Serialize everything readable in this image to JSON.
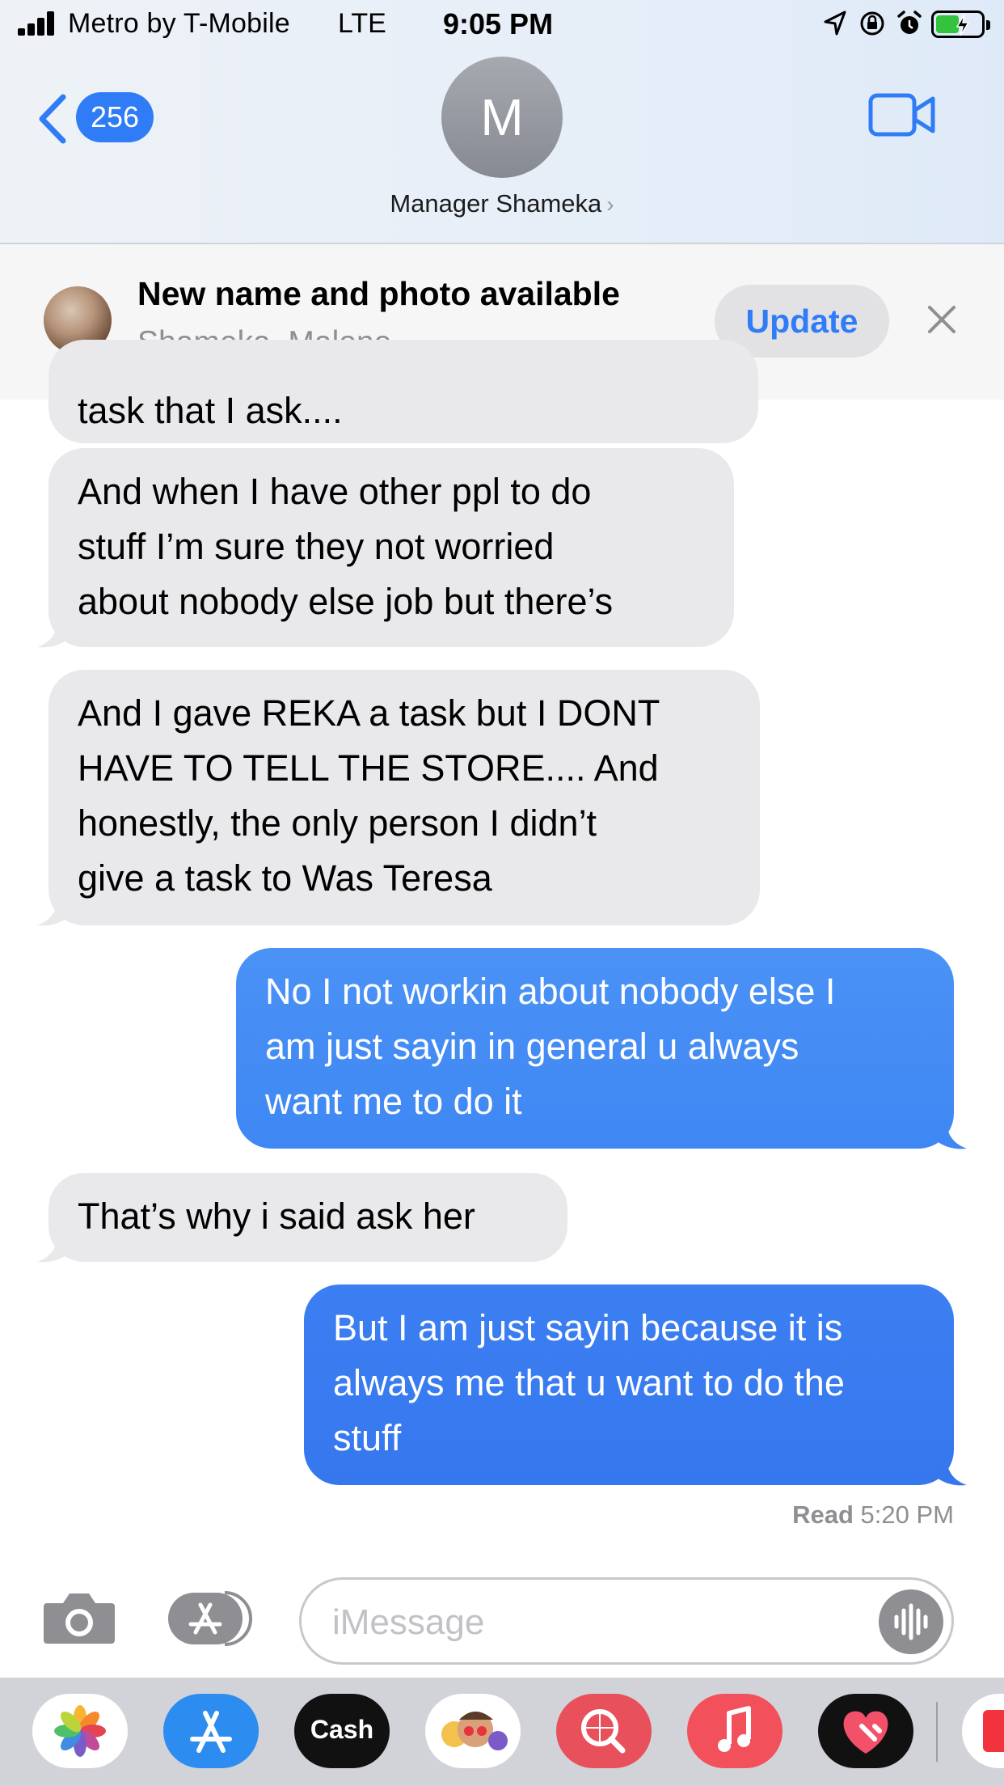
{
  "status_bar": {
    "carrier": "Metro by T-Mobile",
    "network": "LTE",
    "time": "9:05 PM",
    "icons": [
      "signal-bars-icon",
      "location-arrow-icon",
      "orientation-lock-icon",
      "alarm-icon",
      "battery-charging-icon"
    ]
  },
  "header": {
    "back_count": "256",
    "avatar_initial": "M",
    "contact_name": "Manager Shameka",
    "chevron": "›",
    "video_icon": "video-camera-icon"
  },
  "banner": {
    "title": "New name and photo available",
    "subtitle": "Shameka  Malone",
    "update_label": "Update",
    "close_icon": "close-icon"
  },
  "messages": [
    {
      "direction": "incoming",
      "text": "task that I ask...."
    },
    {
      "direction": "incoming",
      "text": "And when I have other ppl to do\nstuff I’m sure they not worried\nabout nobody else job but there’s"
    },
    {
      "direction": "incoming",
      "text": "And I gave REKA a task but I DONT\nHAVE TO TELL THE STORE.... And\nhonestly, the only person I didn’t\ngive a task to Was Teresa"
    },
    {
      "direction": "outgoing",
      "text": " No I not workin about nobody else I\nam just sayin in general u always\nwant me to do it"
    },
    {
      "direction": "incoming",
      "text": "That’s why i said ask her"
    },
    {
      "direction": "outgoing",
      "text": "But I am just sayin because it is\nalways me that u want to do the\nstuff"
    }
  ],
  "read_receipt": {
    "label": "Read",
    "time": "5:20 PM"
  },
  "composer": {
    "placeholder": "iMessage"
  },
  "app_drawer": {
    "apps": [
      "Photos",
      "App Store",
      "Cash",
      "Memoji",
      "Search Images",
      "Music",
      "Digital Touch"
    ],
    "cash_label": "Cash"
  },
  "colors": {
    "incoming_bubble": "#e9e9eb",
    "outgoing_bubble": "#3b82f4",
    "accent": "#2f7cf6"
  }
}
